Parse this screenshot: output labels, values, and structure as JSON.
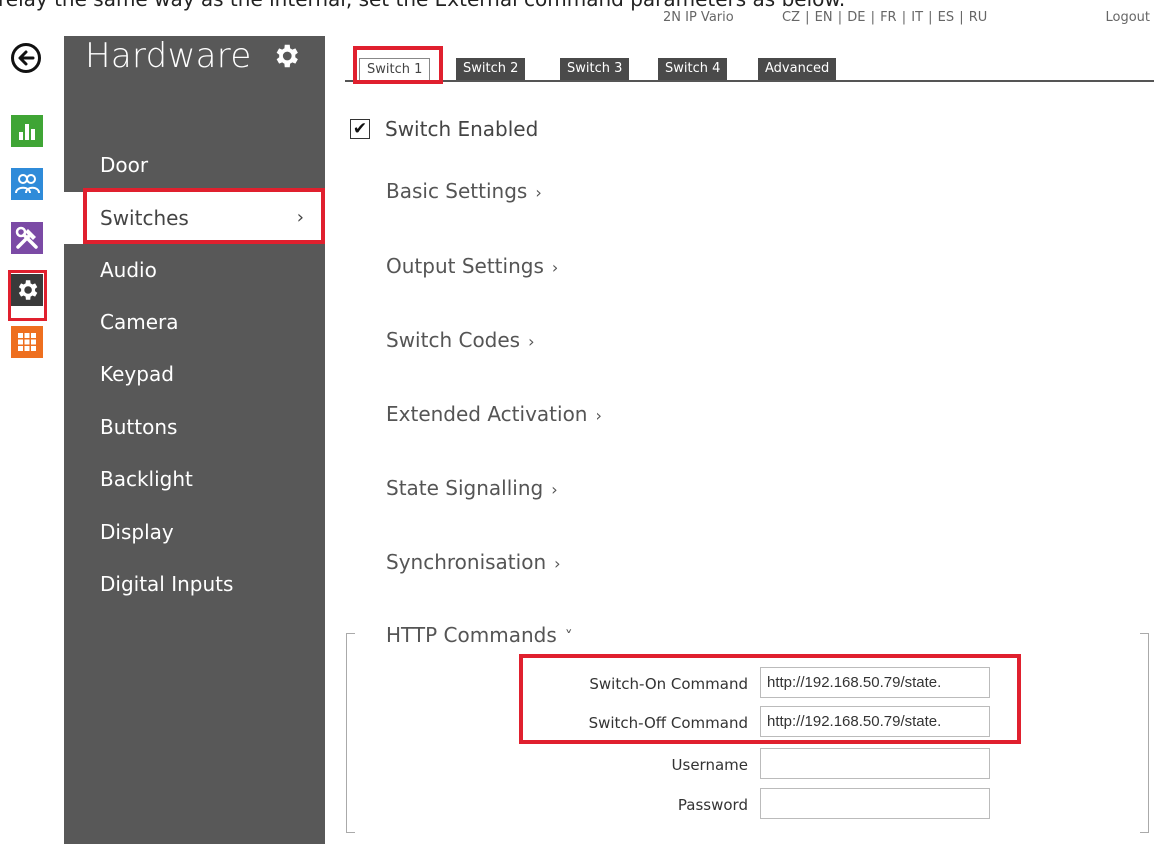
{
  "caption": "relay the same way as the internal, set the External command parameters as below.",
  "header": {
    "device": "2N IP Vario",
    "languages": "CZ | EN | DE | FR | IT | ES | RU",
    "logout": "Logout"
  },
  "rail": {
    "icons": [
      "back-icon",
      "chart-icon",
      "users-icon",
      "tools-icon",
      "gear-icon",
      "grid-icon"
    ]
  },
  "sidebar": {
    "title": "Hardware",
    "items": [
      {
        "label": "Door"
      },
      {
        "label": "Switches",
        "chevron": "›"
      },
      {
        "label": "Audio"
      },
      {
        "label": "Camera"
      },
      {
        "label": "Keypad"
      },
      {
        "label": "Buttons"
      },
      {
        "label": "Backlight"
      },
      {
        "label": "Display"
      },
      {
        "label": "Digital Inputs"
      }
    ]
  },
  "tabs": [
    "Switch 1",
    "Switch 2",
    "Switch 3",
    "Switch 4",
    "Advanced"
  ],
  "content": {
    "switch_enabled": "Switch Enabled",
    "sections": [
      {
        "label": "Basic Settings",
        "chevron": "›"
      },
      {
        "label": "Output Settings",
        "chevron": "›"
      },
      {
        "label": "Switch Codes",
        "chevron": "›"
      },
      {
        "label": "Extended Activation",
        "chevron": "›"
      },
      {
        "label": "State Signalling",
        "chevron": "›"
      },
      {
        "label": "Synchronisation",
        "chevron": "›"
      },
      {
        "label": "HTTP Commands",
        "chevron": "˅"
      }
    ],
    "http": {
      "on_label": "Switch-On Command",
      "on_value": "http://192.168.50.79/state.",
      "off_label": "Switch-Off Command",
      "off_value": "http://192.168.50.79/state.",
      "username_label": "Username",
      "username_value": "",
      "password_label": "Password",
      "password_value": ""
    }
  },
  "colors": {
    "highlight": "#e0202e",
    "sidebar": "#585858",
    "tab": "#4a4a4a"
  }
}
